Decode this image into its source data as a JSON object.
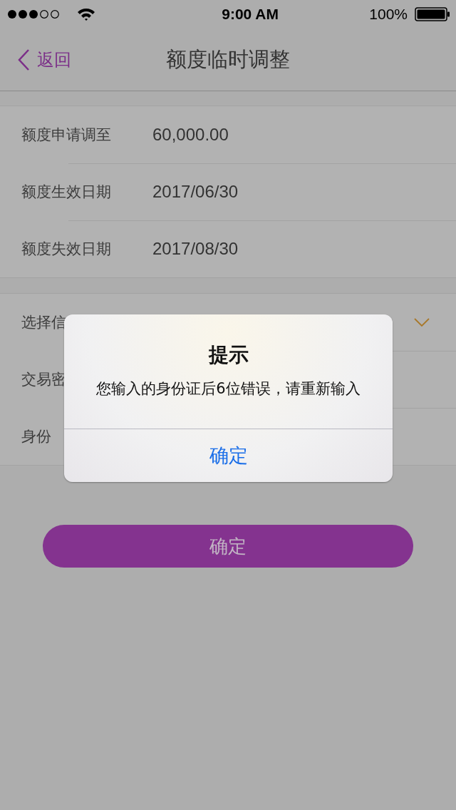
{
  "status_bar": {
    "time": "9:00 AM",
    "battery": "100%"
  },
  "nav": {
    "back": "返回",
    "title": "额度临时调整"
  },
  "info_rows": [
    {
      "label": "额度申请调至",
      "value": "60,000.00"
    },
    {
      "label": "额度生效日期",
      "value": "2017/06/30"
    },
    {
      "label": "额度失效日期",
      "value": "2017/08/30"
    }
  ],
  "form_rows": [
    {
      "label": "选择信",
      "kind": "dropdown"
    },
    {
      "label": "交易密",
      "kind": "text"
    },
    {
      "label": "身份",
      "kind": "text"
    }
  ],
  "submit": "确定",
  "alert": {
    "title": "提示",
    "message": "您输入的身份证后6位错误，请重新输入",
    "button": "确定"
  }
}
